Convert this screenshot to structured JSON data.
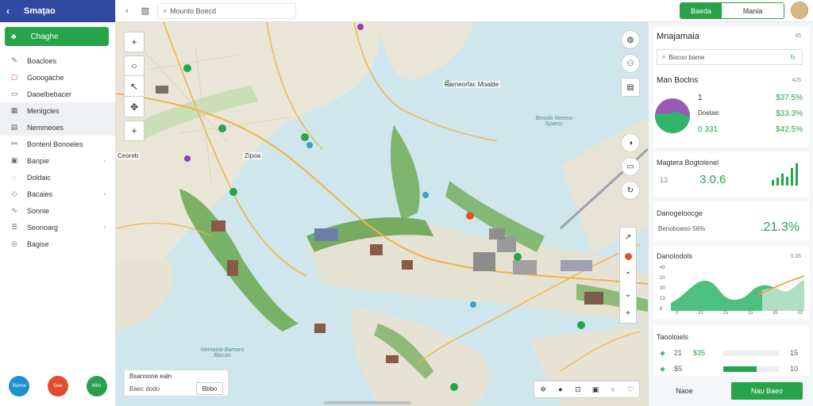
{
  "sidebar": {
    "title": "Smaţao",
    "primary_button": "Chaghe",
    "items": [
      {
        "label": "Boacloes",
        "icon": "pencil-icon",
        "chevron": false
      },
      {
        "label": "Gooogache",
        "icon": "square-icon",
        "chevron": false
      },
      {
        "label": "Daoelbebacer",
        "icon": "doc-icon",
        "chevron": false
      },
      {
        "label": "Menigcles",
        "icon": "grid-icon",
        "chevron": false
      },
      {
        "label": "Nemmeoes",
        "icon": "layers-icon",
        "chevron": false
      },
      {
        "label": "Bontenl Bonoeles",
        "icon": "link-icon",
        "chevron": false
      },
      {
        "label": "Banpie",
        "icon": "box-icon",
        "chevron": true
      },
      {
        "label": "Doldaic",
        "icon": "bulb-icon",
        "chevron": false
      },
      {
        "label": "Bacaies",
        "icon": "tag-icon",
        "chevron": true
      },
      {
        "label": "Sonnie",
        "icon": "wave-icon",
        "chevron": false
      },
      {
        "label": "Seonoarg",
        "icon": "sliders-icon",
        "chevron": true
      },
      {
        "label": "Bagise",
        "icon": "circle-icon",
        "chevron": false
      }
    ],
    "bottom": [
      {
        "label": "Bulme",
        "color": "#1e8fd0"
      },
      {
        "label": "Gae",
        "color": "#e24b2b"
      },
      {
        "label": "Mhn",
        "color": "#28a14a"
      }
    ]
  },
  "topbar": {
    "search_text": "Mounto Boecd",
    "seg_active": "Baeda",
    "seg_inactive": "Mania"
  },
  "map": {
    "labels": [
      {
        "text": "Rarneorfac Moalde"
      },
      {
        "text": "Ceoreb"
      },
      {
        "text": "Zipoa"
      }
    ],
    "water_labels": [
      "Beoola Nereou Spaesc",
      "Nemaoia Bamaro Bacuto"
    ],
    "legend_title": "Bsanoone ealn",
    "legend_field": "Baec dodo",
    "legend_button": "Bbbo"
  },
  "panel": {
    "title": "Mnajamaia",
    "title_meta": "45",
    "search_placeholder": "Bocoo bame",
    "stats": {
      "title": "Man Boclns",
      "meta": "425",
      "rows": [
        {
          "k": "1",
          "v": "$37.5%"
        },
        {
          "k": "Doetaic",
          "v": "$33.3%"
        },
        {
          "k": "0 331",
          "v": "$42.5%"
        }
      ]
    },
    "forecast": {
      "title": "Magtera Bogtolenel",
      "meta": "13",
      "value": "3.0.6",
      "bars": [
        0.25,
        0.35,
        0.55,
        0.4,
        0.8,
        1.0
      ]
    },
    "trend": {
      "title": "Danogeloocge",
      "label": "Benoboeoo 56%",
      "value": ".21.3%"
    },
    "chart": {
      "title": "Danolodols",
      "meta": "3.06",
      "y_ticks": [
        "40",
        "20",
        "30",
        "13",
        "8"
      ],
      "x_ticks": [
        "3",
        "33",
        "15",
        "15",
        "35",
        "33"
      ]
    },
    "table": {
      "title": "Taooloiels",
      "rows": [
        {
          "a": "21",
          "b": "$35",
          "bar": 0.0,
          "bar_color": "#e2542a",
          "c": "15"
        },
        {
          "a": "$5",
          "b": "",
          "bar": 0.6,
          "bar_color": "#27a34a",
          "c": "10"
        }
      ]
    },
    "buttons": {
      "secondary": "Naoe",
      "primary": "Nau Baeo"
    }
  }
}
